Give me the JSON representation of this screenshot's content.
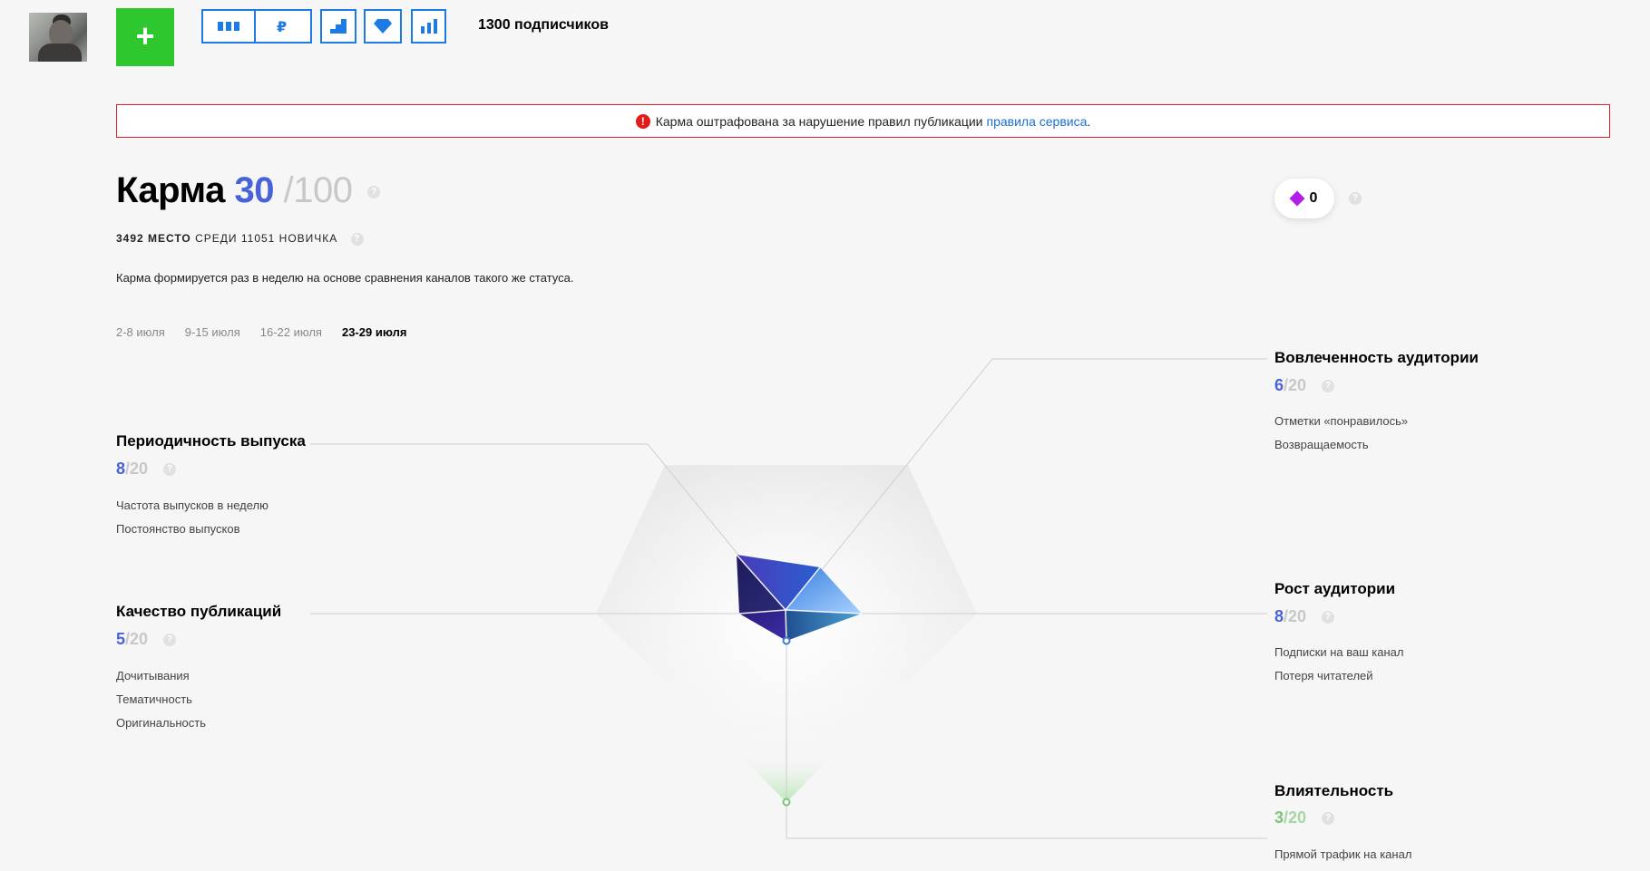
{
  "header": {
    "add_label": "+",
    "subscribers": "1300 подписчиков",
    "toolbar": [
      {
        "name": "stats-columns-icon"
      },
      {
        "name": "ruble-icon"
      },
      {
        "name": "stairs-icon"
      },
      {
        "name": "diamond-icon"
      },
      {
        "name": "bar-chart-icon"
      }
    ]
  },
  "alert": {
    "text": "Карма оштрафована за нарушение правил публикации",
    "link": "правила сервиса",
    "dot": ".",
    "icon_glyph": "!",
    "color": "#d9212a"
  },
  "karma": {
    "title": "Карма",
    "value": "30",
    "max": "/100",
    "rank_place": "3492 место",
    "rank_rest": "среди 11051 новичка",
    "description": "Карма формируется раз в неделю на основе сравнения каналов такого же статуса.",
    "help": "?"
  },
  "weeks": [
    "2-8 июля",
    "9-15 июля",
    "16-22 июля",
    "23-29 июля"
  ],
  "active_week": "23-29 июля",
  "diamonds": {
    "count": "0"
  },
  "metrics": {
    "engagement": {
      "title": "Вовлеченность аудитории",
      "value": "6",
      "max": "/20",
      "items": [
        "Отметки «понравилось»",
        "Возвращаемость"
      ]
    },
    "periodicity": {
      "title": "Периодичность выпуска",
      "value": "8",
      "max": "/20",
      "items": [
        "Частота выпусков в неделю",
        "Постоянство выпусков"
      ]
    },
    "quality": {
      "title": "Качество публикаций",
      "value": "5",
      "max": "/20",
      "items": [
        "Дочитывания",
        "Тематичность",
        "Оригинальность"
      ]
    },
    "growth": {
      "title": "Рост аудитории",
      "value": "8",
      "max": "/20",
      "items": [
        "Подписки на ваш канал",
        "Потеря читателей"
      ]
    },
    "influence": {
      "title": "Влиятельность",
      "value": "3",
      "max": "/20",
      "items": [
        "Прямой трафик на канал"
      ]
    }
  },
  "colors": {
    "accent": "#4862d9",
    "add_button": "#2ec72e",
    "toolbar_border": "#1e7be6",
    "influence": "#7cc47c",
    "diamond": "#b21fe6"
  }
}
